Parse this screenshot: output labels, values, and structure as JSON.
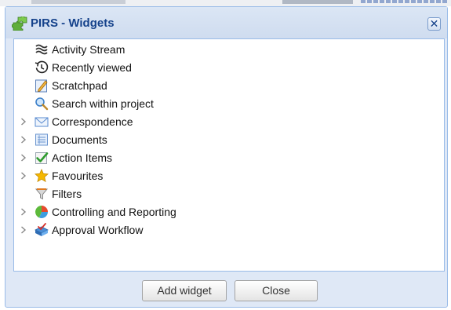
{
  "dialog": {
    "title": "PIRS - Widgets",
    "close_glyph": "✕",
    "title_icon": "puzzle-icon"
  },
  "tree": {
    "items": [
      {
        "label": "Activity Stream",
        "icon": "activity-stream-icon",
        "expandable": false
      },
      {
        "label": "Recently viewed",
        "icon": "history-clock-icon",
        "expandable": false
      },
      {
        "label": "Scratchpad",
        "icon": "scratchpad-icon",
        "expandable": false
      },
      {
        "label": "Search within project",
        "icon": "magnifier-icon",
        "expandable": false
      },
      {
        "label": "Correspondence",
        "icon": "envelope-icon",
        "expandable": true
      },
      {
        "label": "Documents",
        "icon": "documents-icon",
        "expandable": true
      },
      {
        "label": "Action Items",
        "icon": "checkmark-icon",
        "expandable": true
      },
      {
        "label": "Favourites",
        "icon": "star-icon",
        "expandable": true
      },
      {
        "label": "Filters",
        "icon": "funnel-icon",
        "expandable": false
      },
      {
        "label": "Controlling and Reporting",
        "icon": "pie-chart-icon",
        "expandable": true
      },
      {
        "label": "Approval Workflow",
        "icon": "approval-icon",
        "expandable": true
      }
    ]
  },
  "buttons": {
    "add_label": "Add widget",
    "close_label": "Close"
  },
  "colors": {
    "title_text": "#15428b",
    "dialog_bg": "#dfe8f6",
    "border": "#99bbe8"
  }
}
